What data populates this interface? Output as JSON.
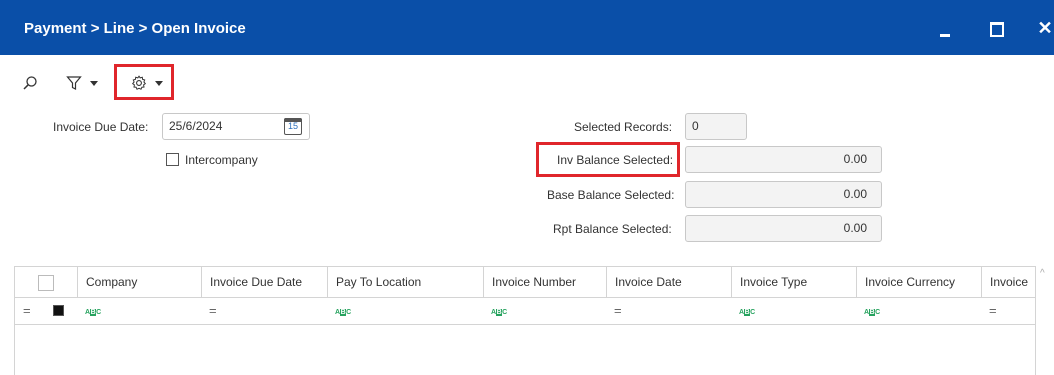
{
  "window": {
    "title": "Payment > Line > Open Invoice",
    "minimize_label": "",
    "maximize_label": "",
    "close_label": "✕"
  },
  "toolbar": {
    "icons": [
      "search-icon",
      "filter-icon",
      "gear-icon"
    ]
  },
  "form": {
    "invoice_due_date_label": "Invoice Due Date:",
    "invoice_due_date_value": "25/6/2024",
    "calendar_day": "15",
    "intercompany_label": "Intercompany",
    "intercompany_checked": false,
    "selected_records_label": "Selected Records:",
    "selected_records_value": "0",
    "inv_balance_label": "Inv Balance Selected:",
    "inv_balance_value": "0.00",
    "base_balance_label": "Base Balance Selected:",
    "base_balance_value": "0.00",
    "rpt_balance_label": "Rpt Balance Selected:",
    "rpt_balance_value": "0.00"
  },
  "grid": {
    "columns": [
      "Company",
      "Invoice Due Date",
      "Pay To Location",
      "Invoice Number",
      "Invoice Date",
      "Invoice Type",
      "Invoice Currency",
      "Invoice"
    ],
    "filter_types": [
      "text",
      "equals",
      "text",
      "text",
      "equals",
      "text",
      "text",
      "equals"
    ],
    "rows": []
  },
  "colors": {
    "titlebar": "#0a4fa8",
    "highlight": "#e0262b",
    "text_filter": "#27a35f"
  }
}
